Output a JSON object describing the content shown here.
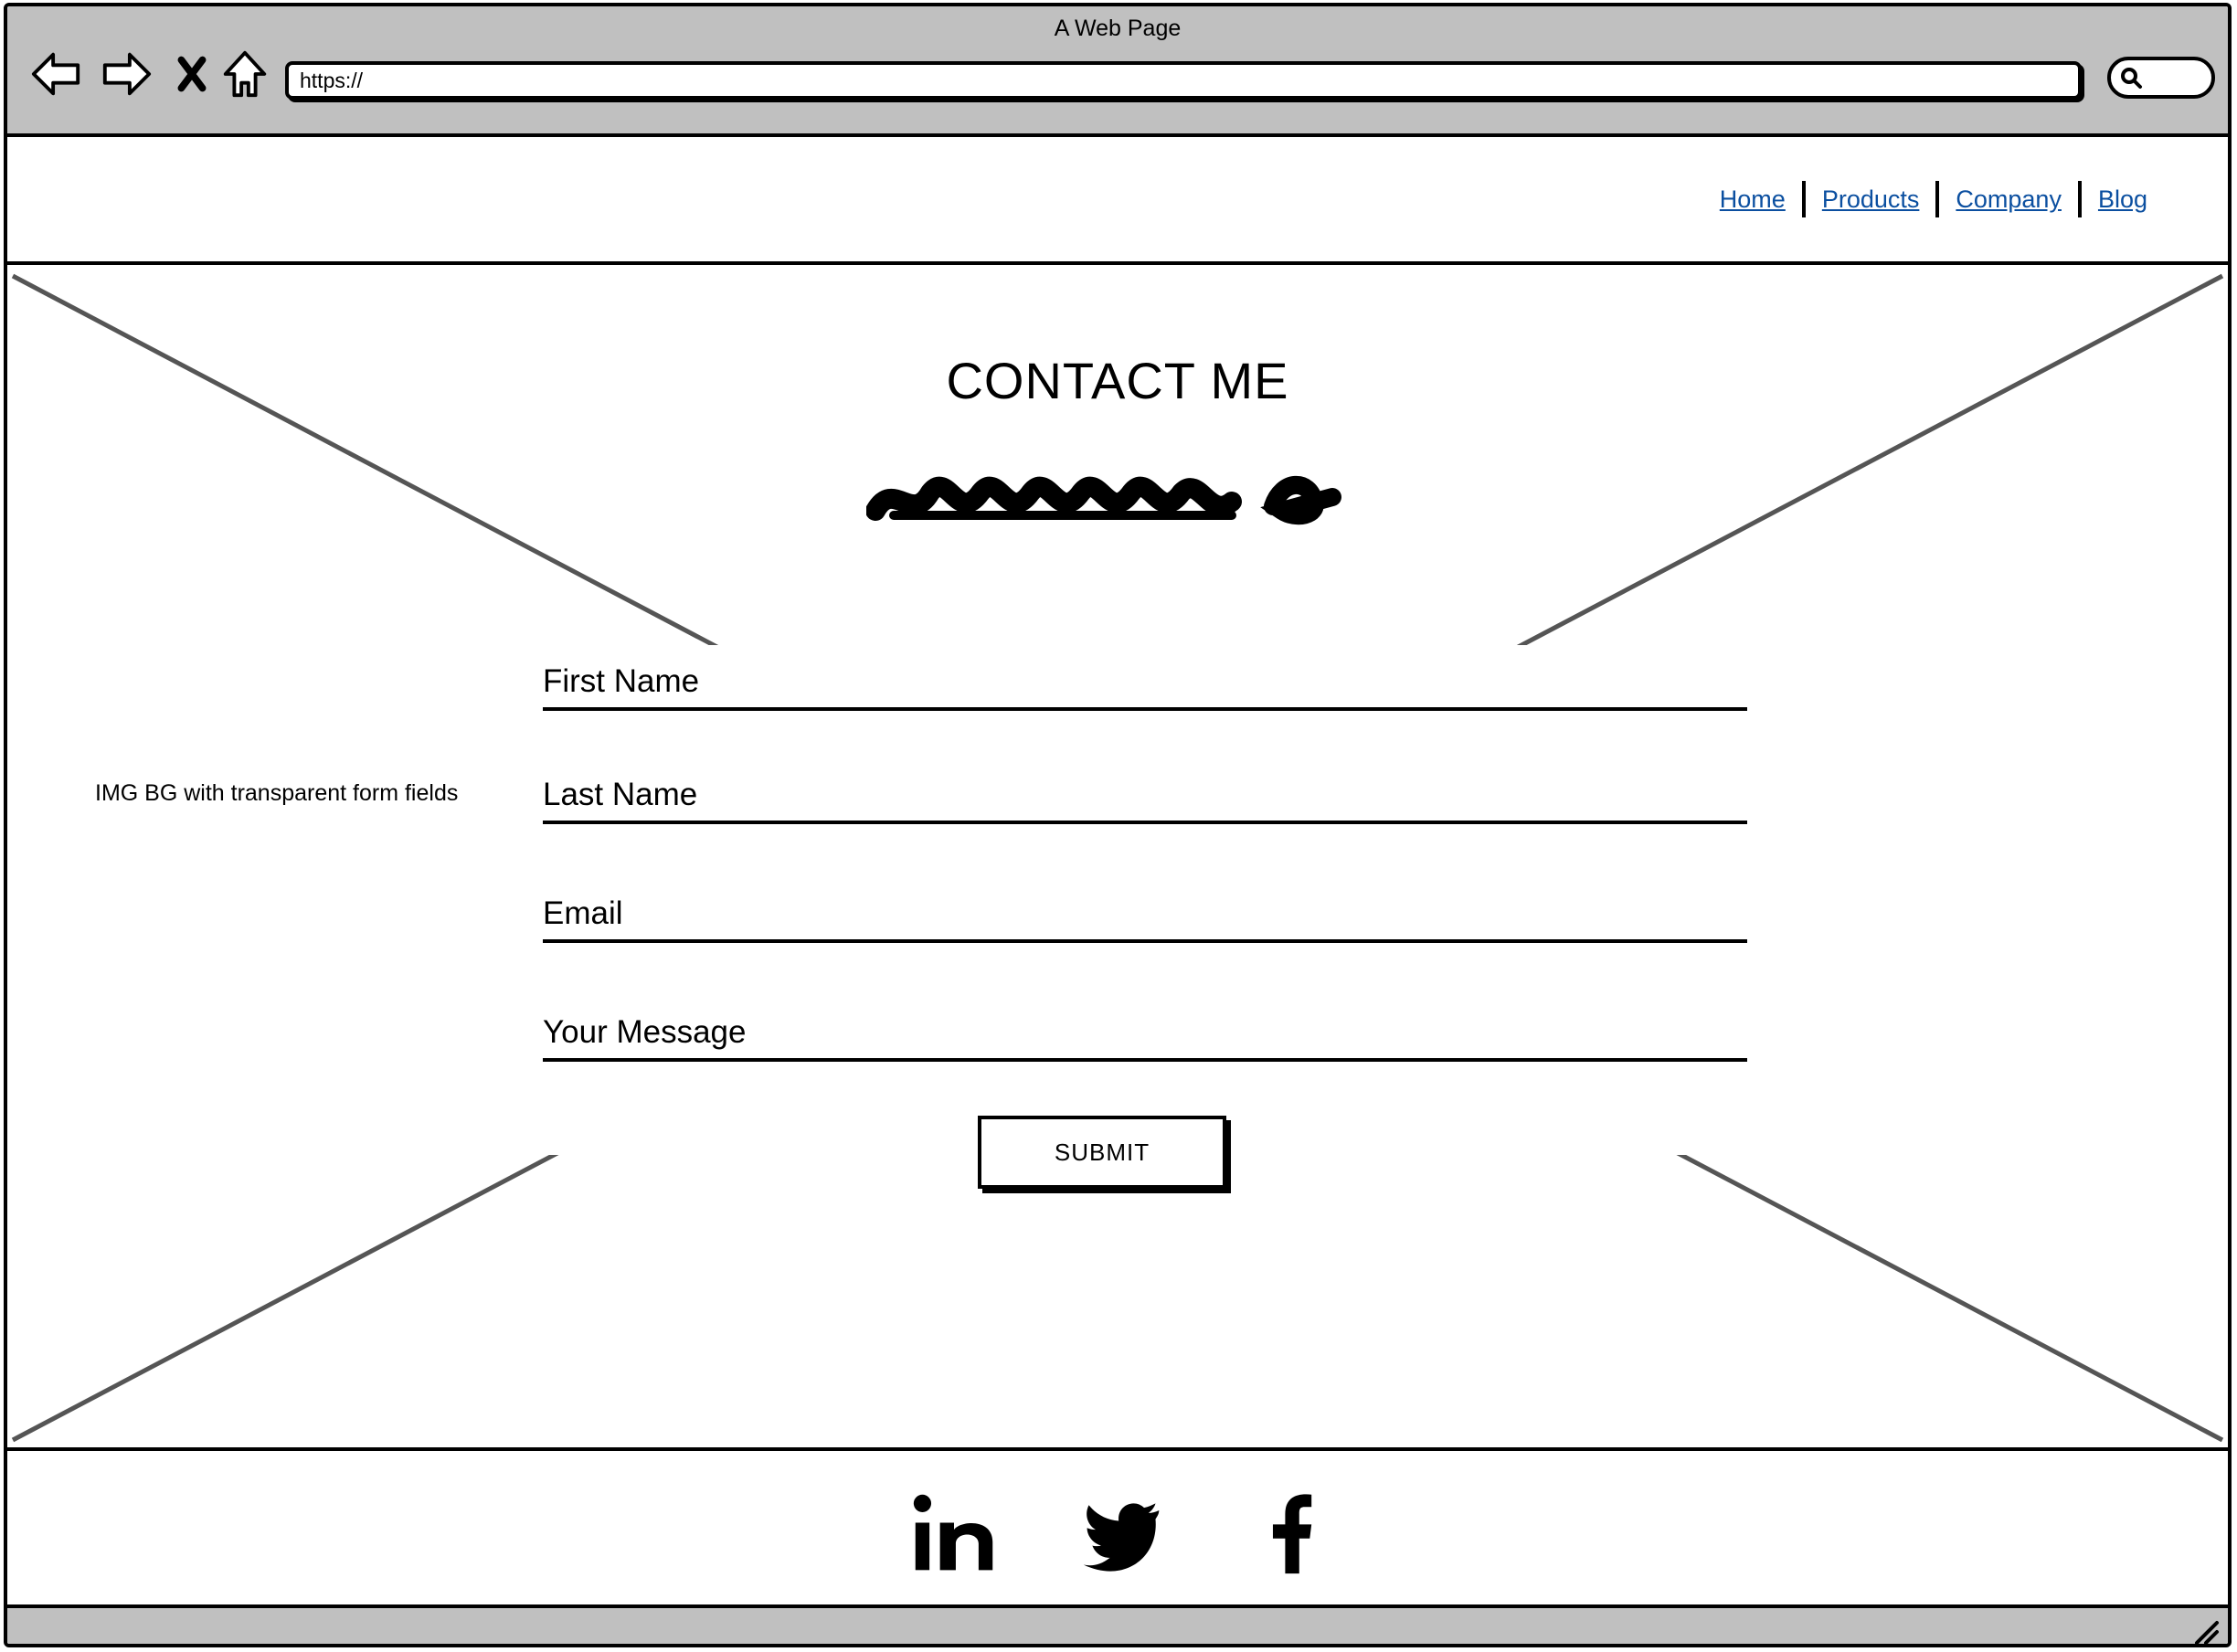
{
  "window": {
    "title": "A Web Page"
  },
  "toolbar": {
    "back_icon": "arrow-left-icon",
    "forward_icon": "arrow-right-icon",
    "stop_icon": "close-icon",
    "home_icon": "home-icon",
    "url": "https://",
    "search_icon": "search-icon"
  },
  "nav": {
    "items": [
      {
        "label": "Home"
      },
      {
        "label": "Products"
      },
      {
        "label": "Company"
      },
      {
        "label": "Blog"
      }
    ],
    "link_color": "#0b4fa0"
  },
  "hero": {
    "title": "CONTACT ME",
    "background_note": "IMG BG with transparent form fields",
    "background_placeholder": "image-placeholder-x",
    "scribble": "scribbled-text"
  },
  "form": {
    "fields": [
      {
        "label": "First Name"
      },
      {
        "label": "Last Name"
      },
      {
        "label": "Email"
      },
      {
        "label": "Your Message"
      }
    ],
    "submit_label": "SUBMIT"
  },
  "footer": {
    "social": [
      {
        "icon": "linkedin-icon"
      },
      {
        "icon": "twitter-icon"
      },
      {
        "icon": "facebook-icon"
      }
    ]
  },
  "colors": {
    "chrome": "#c0c0c0",
    "placeholder_lines": "#555555"
  }
}
